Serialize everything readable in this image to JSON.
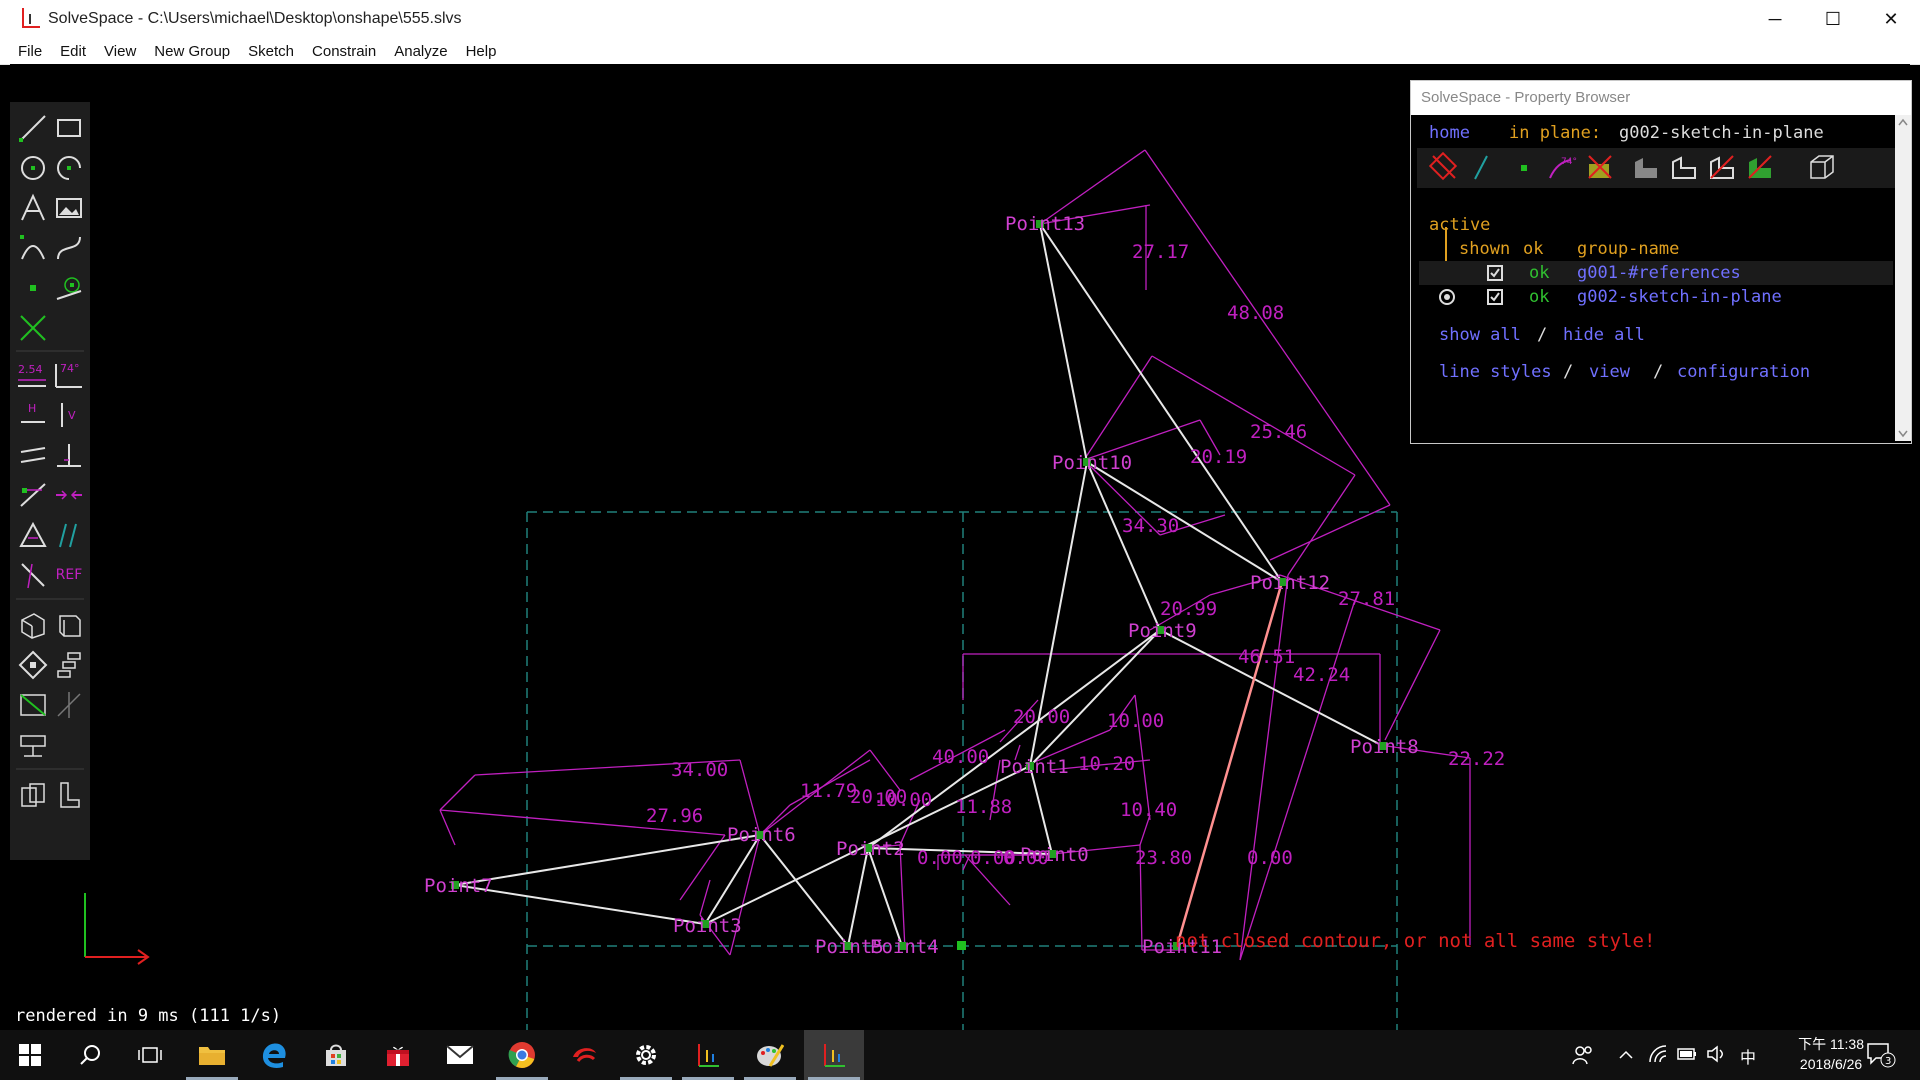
{
  "window": {
    "title": "SolveSpace - C:\\Users\\michael\\Desktop\\onshape\\555.slvs",
    "minimize_glyph": "─",
    "maximize_glyph": "☐",
    "close_glyph": "✕"
  },
  "menu": [
    "File",
    "Edit",
    "View",
    "New Group",
    "Sketch",
    "Constrain",
    "Analyze",
    "Help"
  ],
  "toolbar": {
    "dimension_label": "2.54",
    "angle_label": "74°",
    "horizontal_label": "H",
    "vertical_label": "V",
    "ref_label": "REF"
  },
  "property_browser": {
    "title": "SolveSpace - Property Browser",
    "home_link": "home",
    "in_plane_label": "in plane:",
    "in_plane_value": "g002-sketch-in-plane",
    "active_label": "active",
    "header_shown": "shown",
    "header_ok": "ok",
    "header_group_name": "group-name",
    "groups": [
      {
        "ok": "ok",
        "name": "g001-#references"
      },
      {
        "ok": "ok",
        "name": "g002-sketch-in-plane"
      }
    ],
    "show_all": "show all",
    "hide_all": "hide all",
    "slash": "/",
    "line_styles": "line styles",
    "view": "view",
    "configuration": "configuration",
    "icons": [
      "occluded-lines-icon",
      "construction-icon",
      "points-icon",
      "constraints-icon",
      "faces-icon",
      "shaded-icon",
      "edges-icon",
      "outline-icon",
      "mesh-icon",
      "workplane-icon"
    ]
  },
  "sketch": {
    "points": [
      {
        "label": "Point13"
      },
      {
        "label": "Point10"
      },
      {
        "label": "Point12"
      },
      {
        "label": "Point9"
      },
      {
        "label": "Point8"
      },
      {
        "label": "Point7"
      },
      {
        "label": "Point6"
      },
      {
        "label": "Point2"
      },
      {
        "label": "Point1"
      },
      {
        "label": "Point0"
      },
      {
        "label": "Point3"
      },
      {
        "label": "Point5"
      },
      {
        "label": "Point4"
      },
      {
        "label": "Point11"
      }
    ],
    "dimensions": [
      "27.17",
      "48.08",
      "25.46",
      "20.19",
      "34.30",
      "20.99",
      "27.81",
      "46.51",
      "42.24",
      "22.22",
      "20.00",
      "10.00",
      "40.00",
      "10.20",
      "34.00",
      "27.96",
      "11.79",
      "20.00",
      "10.00",
      "11.88",
      "10.40",
      "0.00",
      "0.00",
      "0.00",
      "23.80",
      "0.00"
    ],
    "warning": "not closed contour, or not all same style!"
  },
  "status": "rendered in 9 ms (111 1/s)",
  "taskbar": {
    "apps": [
      "start-icon",
      "search-icon",
      "task-view-icon",
      "file-explorer-icon",
      "edge-icon",
      "store-icon",
      "gift-icon",
      "mail-icon",
      "chrome-icon",
      "app-red-icon",
      "settings-icon",
      "solvespace-icon",
      "paint-icon",
      "solvespace-active-icon"
    ],
    "time": "下午 11:38",
    "date": "2018/6/26",
    "ime": "中",
    "notification_count": "3"
  },
  "colors": {
    "magenta": "#c020c0",
    "point_label": "#d040d0",
    "warning_red": "#e02020",
    "line_white": "#e8e8e8",
    "teal_dash": "#20807a",
    "pb_blue": "#7070ff",
    "pb_orange": "#e0a020",
    "pb_green": "#30c030"
  }
}
